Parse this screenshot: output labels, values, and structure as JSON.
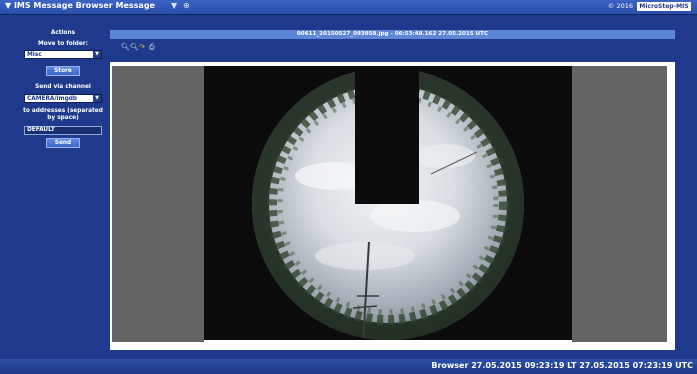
{
  "titlebar": {
    "title": "▼ IMS Message Browser Message",
    "tab_ctrl_1": "▼",
    "tab_ctrl_2": "⊕",
    "copyright": "© 2016",
    "brand": "MicroStep-MIS"
  },
  "actions": {
    "heading": "Actions",
    "move_label": "Move to folder:",
    "folder_value": "Misc",
    "store_button": "Store",
    "send_label": "Send via channel",
    "channel_value": "CAMERA/imgdb",
    "to_label": "to addresses (separated by space)",
    "address_value": "DEFAULT",
    "send_button": "Send"
  },
  "viewer": {
    "filename": "00611_20150527_093858.jpg - 06:53:48.162 27.05.2015 UTC",
    "tools": [
      "zoom-in-icon",
      "zoom-out-icon",
      "rotate-icon",
      "print-icon"
    ]
  },
  "status": {
    "text": "Browser  27.05.2015 09:23:19 LT  27.05.2015 07:23:19 UTC"
  },
  "colors": {
    "background": "#1f3a8c",
    "bar": "#5d86d6",
    "button": "#4a74d4"
  }
}
